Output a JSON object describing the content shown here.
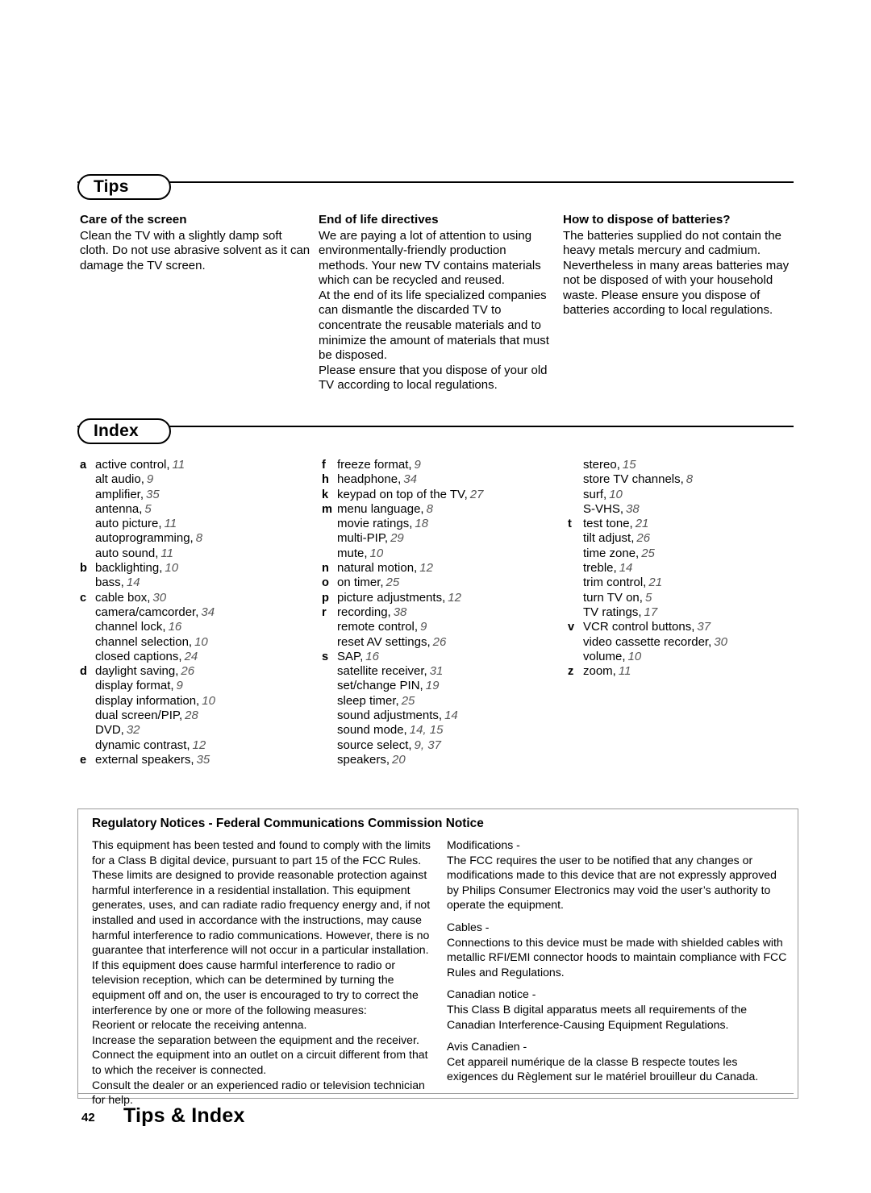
{
  "document": {
    "page_number": "42",
    "footer_title": "Tips & Index"
  },
  "tips": {
    "section_label": "Tips",
    "columns": [
      {
        "title": "Care of the screen",
        "paragraphs": [
          "Clean the TV with a slightly damp soft cloth. Do not use abrasive solvent as it can damage the TV screen."
        ]
      },
      {
        "title": "End of life directives",
        "paragraphs": [
          "We are paying a lot of attention to using environmentally-friendly production methods. Your new TV contains materials which can be recycled and reused.",
          "At the end of its life specialized companies can dismantle the discarded TV to concentrate the reusable materials and to minimize the amount of materials that must be disposed.",
          "Please ensure that you dispose of your old TV according to local regulations."
        ]
      },
      {
        "title": "How to dispose of batteries?",
        "paragraphs": [
          "The batteries supplied do not contain the heavy metals mercury and cadmium. Nevertheless in many areas batteries may not be disposed of with your household waste. Please ensure you dispose of batteries according to local regulations."
        ]
      }
    ]
  },
  "index": {
    "section_label": "Index",
    "columns": [
      [
        {
          "letter": "a",
          "term": "active control,",
          "page": "11"
        },
        {
          "letter": "",
          "term": "alt audio,",
          "page": "9"
        },
        {
          "letter": "",
          "term": "amplifier,",
          "page": "35"
        },
        {
          "letter": "",
          "term": "antenna,",
          "page": "5"
        },
        {
          "letter": "",
          "term": "auto picture,",
          "page": "11"
        },
        {
          "letter": "",
          "term": "autoprogramming,",
          "page": "8"
        },
        {
          "letter": "",
          "term": "auto sound,",
          "page": "11"
        },
        {
          "letter": "b",
          "term": "backlighting,",
          "page": "10"
        },
        {
          "letter": "",
          "term": "bass,",
          "page": "14"
        },
        {
          "letter": "c",
          "term": "cable box,",
          "page": "30"
        },
        {
          "letter": "",
          "term": "camera/camcorder,",
          "page": "34"
        },
        {
          "letter": "",
          "term": "channel lock,",
          "page": "16"
        },
        {
          "letter": "",
          "term": "channel selection,",
          "page": "10"
        },
        {
          "letter": "",
          "term": "closed captions,",
          "page": "24"
        },
        {
          "letter": "d",
          "term": "daylight saving,",
          "page": "26"
        },
        {
          "letter": "",
          "term": "display format,",
          "page": "9"
        },
        {
          "letter": "",
          "term": "display information,",
          "page": "10"
        },
        {
          "letter": "",
          "term": "dual screen/PIP,",
          "page": "28"
        },
        {
          "letter": "",
          "term": "DVD,",
          "page": "32"
        },
        {
          "letter": "",
          "term": "dynamic contrast,",
          "page": "12"
        },
        {
          "letter": "e",
          "term": "external speakers,",
          "page": "35"
        }
      ],
      [
        {
          "letter": "f",
          "term": "freeze format,",
          "page": "9"
        },
        {
          "letter": "h",
          "term": "headphone,",
          "page": "34"
        },
        {
          "letter": "k",
          "term": "keypad on top of the TV,",
          "page": "27"
        },
        {
          "letter": "m",
          "term": "menu language,",
          "page": "8"
        },
        {
          "letter": "",
          "term": "movie ratings,",
          "page": "18"
        },
        {
          "letter": "",
          "term": "multi-PIP,",
          "page": "29"
        },
        {
          "letter": "",
          "term": "mute,",
          "page": "10"
        },
        {
          "letter": "n",
          "term": "natural motion,",
          "page": "12"
        },
        {
          "letter": "o",
          "term": "on timer,",
          "page": "25"
        },
        {
          "letter": "p",
          "term": "picture adjustments,",
          "page": "12"
        },
        {
          "letter": "r",
          "term": "recording,",
          "page": "38"
        },
        {
          "letter": "",
          "term": "remote control,",
          "page": "9"
        },
        {
          "letter": "",
          "term": "reset AV settings,",
          "page": "26"
        },
        {
          "letter": "s",
          "term": "SAP,",
          "page": "16"
        },
        {
          "letter": "",
          "term": "satellite receiver,",
          "page": "31"
        },
        {
          "letter": "",
          "term": "set/change PIN,",
          "page": "19"
        },
        {
          "letter": "",
          "term": "sleep timer,",
          "page": "25"
        },
        {
          "letter": "",
          "term": "sound adjustments,",
          "page": "14"
        },
        {
          "letter": "",
          "term": "sound mode,",
          "page": "14, 15"
        },
        {
          "letter": "",
          "term": "source select,",
          "page": "9, 37"
        },
        {
          "letter": "",
          "term": "speakers,",
          "page": "20"
        }
      ],
      [
        {
          "letter": "",
          "term": "stereo,",
          "page": "15"
        },
        {
          "letter": "",
          "term": "store TV channels,",
          "page": "8"
        },
        {
          "letter": "",
          "term": "surf,",
          "page": "10"
        },
        {
          "letter": "",
          "term": "S-VHS,",
          "page": "38"
        },
        {
          "letter": "t",
          "term": "test tone,",
          "page": "21"
        },
        {
          "letter": "",
          "term": "tilt adjust,",
          "page": "26"
        },
        {
          "letter": "",
          "term": "time zone,",
          "page": "25"
        },
        {
          "letter": "",
          "term": "treble,",
          "page": "14"
        },
        {
          "letter": "",
          "term": "trim control,",
          "page": "21"
        },
        {
          "letter": "",
          "term": "turn TV on,",
          "page": "5"
        },
        {
          "letter": "",
          "term": "TV ratings,",
          "page": "17"
        },
        {
          "letter": "v",
          "term": "VCR control buttons,",
          "page": "37"
        },
        {
          "letter": "",
          "term": "video cassette recorder,",
          "page": "30"
        },
        {
          "letter": "",
          "term": "volume,",
          "page": "10"
        },
        {
          "letter": "z",
          "term": "zoom,",
          "page": "11"
        }
      ]
    ]
  },
  "regulatory": {
    "title": "Regulatory Notices - Federal Communications Commission Notice",
    "left_paragraphs": [
      "This equipment has been tested and found to comply with the limits for a Class B digital device, pursuant to part 15 of the FCC Rules. These limits are designed to provide reasonable protection against harmful interference in a residential installation. This equipment generates, uses, and can radiate radio frequency energy and, if not installed and used in accordance with the instructions, may cause harmful interference to radio communications. However, there is no guarantee that interference will not occur in a particular installation. If this equipment does cause harmful interference to radio or television reception, which can be determined by turning the equipment off and on, the user is encouraged to try to correct the interference by one or more of the following measures:",
      "Reorient or relocate the receiving antenna.",
      "Increase the separation between the equipment and the receiver.",
      "Connect the equipment into an outlet on a circuit different from that to which the receiver is connected.",
      "Consult the dealer or an experienced radio or television technician for help."
    ],
    "right_blocks": [
      {
        "heading": "Modifications -",
        "body": "The FCC requires the user to be notified that any changes or modifications made to this device that are not expressly approved by Philips Consumer Electronics may void the user’s authority to operate the equipment."
      },
      {
        "heading": "Cables -",
        "body": "Connections to this device must be made with shielded cables with metallic RFI/EMI connector hoods to maintain compliance with FCC Rules and Regulations."
      },
      {
        "heading": "Canadian notice -",
        "body": "This Class B digital apparatus meets all requirements of the Canadian Interference-Causing Equipment Regulations."
      },
      {
        "heading": "Avis Canadien -",
        "body": "Cet appareil numérique de la classe B respecte toutes les exigences du Règlement sur le matériel brouilleur du Canada."
      }
    ]
  }
}
